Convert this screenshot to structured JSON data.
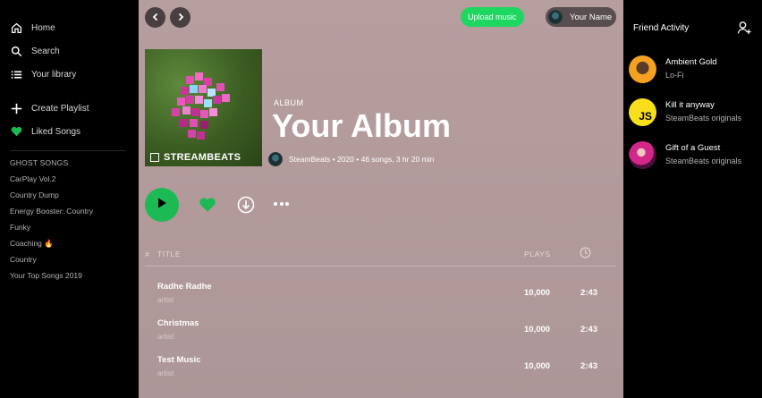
{
  "sidebar": {
    "nav": [
      {
        "label": "Home",
        "icon": "home-icon"
      },
      {
        "label": "Search",
        "icon": "search-icon"
      },
      {
        "label": "Your library",
        "icon": "library-icon"
      }
    ],
    "actions": [
      {
        "label": "Create Playlist",
        "icon": "plus-icon"
      },
      {
        "label": "Liked Songs",
        "icon": "heart-icon"
      }
    ],
    "playlists_heading": "GHOST SONGS",
    "playlists": [
      "CarPlay Vol.2",
      "Country Dump",
      "Energy Booster: Country",
      "Funky",
      "Coaching 🔥",
      "Country",
      "Your Top Songs 2019"
    ]
  },
  "header": {
    "upload_label": "Upload music",
    "user_name": "Your Name"
  },
  "album": {
    "cover_label": "STREAMBEATS",
    "type": "ALBUM",
    "title": "Your Album",
    "meta": "SteamBeats • 2020 • 46 songs, 3 hr 20 min"
  },
  "table": {
    "col_num": "#",
    "col_title": "TITLE",
    "col_plays": "PLAYS",
    "tracks": [
      {
        "title": "Radhe Radhe",
        "artist": "artist",
        "plays": "10,000",
        "duration": "2:43"
      },
      {
        "title": "Christmas",
        "artist": "artist",
        "plays": "10,000",
        "duration": "2:43"
      },
      {
        "title": "Test Music",
        "artist": "artist",
        "plays": "10,000",
        "duration": "2:43"
      }
    ]
  },
  "friend_activity": {
    "title": "Friend Activity",
    "friends": [
      {
        "name": "Ambient Gold",
        "status": "Lo-Fi"
      },
      {
        "name": "Kill it anyway",
        "status": "SteamBeats originals"
      },
      {
        "name": "Gift of a Guest",
        "status": "SteamBeats originals"
      }
    ]
  },
  "colors": {
    "accent_green": "#1db954",
    "main_bg": "#b69d9e",
    "sidebar_bg": "#000000"
  }
}
